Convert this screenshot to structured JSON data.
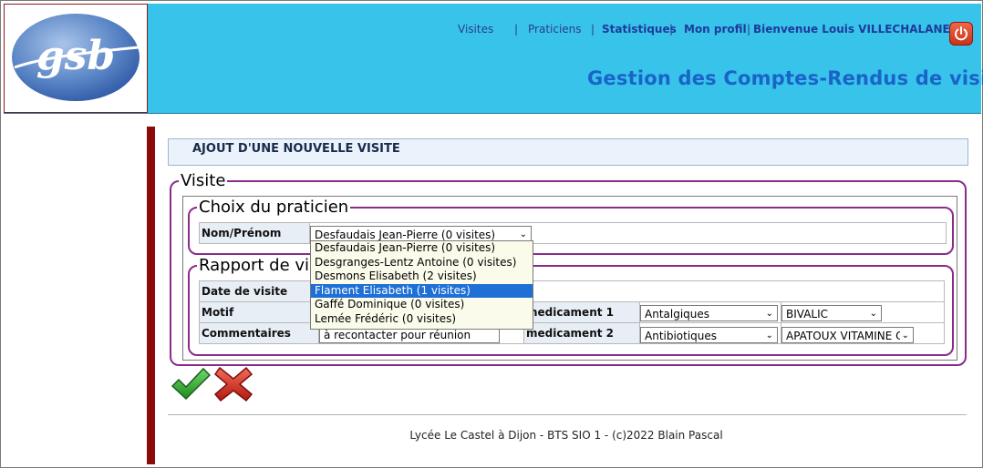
{
  "header": {
    "logo_text": "gsb",
    "nav": {
      "visites": "Visites",
      "sep1": "|",
      "praticiens": "Praticiens",
      "sep2": "|",
      "statistiques": "Statistiques",
      "sep3": "|",
      "mon_profil": "Mon profil",
      "sep4": "|",
      "welcome": "Bienvenue Louis VILLECHALANE"
    },
    "power_icon": "power-icon",
    "app_title": "Gestion des Comptes-Rendus de visites"
  },
  "page_title": "AJOUT D'UNE NOUVELLE VISITE",
  "visite": {
    "legend": "Visite",
    "choix": {
      "legend": "Choix du praticien",
      "nom_label": "Nom/Prénom",
      "selected": "Desfaudais Jean-Pierre (0 visites)",
      "options": [
        "Desfaudais Jean-Pierre (0 visites)",
        "Desgranges-Lentz Antoine (0 visites)",
        "Desmons Elisabeth (2 visites)",
        "Flament Elisabeth (1 visites)",
        "Gaffé Dominique (0 visites)",
        "Lemée Frédéric (0 visites)"
      ],
      "highlighted_index": 3
    },
    "rapport": {
      "legend": "Rapport de visite",
      "date_label": "Date de visite",
      "motif_label": "Motif",
      "commentaires_label": "Commentaires",
      "commentaires_value": "à recontacter pour réunion",
      "medicament1_label": "medicament 1",
      "medicament2_label": "medicament 2",
      "med1_famille": "Antalgiques",
      "med1_produit": "BIVALIC",
      "med2_famille": "Antibiotiques",
      "med2_produit": "APATOUX VITAMINE C"
    }
  },
  "actions": {
    "validate_icon": "checkmark-icon",
    "cancel_icon": "cross-icon"
  },
  "footer": "Lycée Le Castel à Dijon - BTS SIO 1 - (c)2022 Blain Pascal",
  "colors": {
    "header_bg": "#38c3ea",
    "title_blue": "#1a63c8",
    "fieldset_border": "#8a2b8a",
    "left_bar": "#8b0a0a",
    "highlight": "#1e6fd6"
  }
}
